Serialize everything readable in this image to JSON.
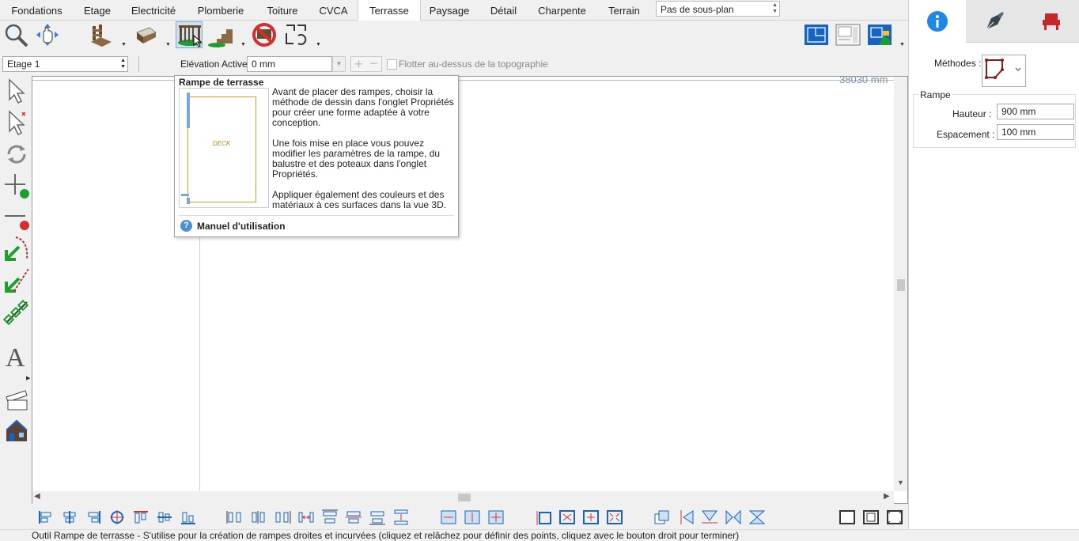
{
  "tabs": [
    "Fondations",
    "Etage",
    "Electricité",
    "Plomberie",
    "Toiture",
    "CVCA",
    "Terrasse",
    "Paysage",
    "Détail",
    "Charpente",
    "Terrain"
  ],
  "active_tab": "Terrasse",
  "subplan_select": "Pas de sous-plan",
  "level_select": "Etage 1",
  "elevation": {
    "label": "Elévation Active:",
    "value": "0 mm"
  },
  "float_checkbox": {
    "label": "Flotter au-dessus de la topographie",
    "checked": false
  },
  "canvas": {
    "dimension_text": "38030 mm"
  },
  "tooltip": {
    "title": "Rampe de terrasse",
    "preview_label": "DECK",
    "paragraphs": [
      "Avant de placer des rampes, choisir la méthode de dessin dans l'onglet Propriétés pour créer une forme adaptée à votre conception.",
      "Une fois mise en place vous pouvez modifier les paramètres de la rampe, du balustre et des poteaux dans l'onglet Propriétés.",
      "Appliquer également des couleurs et des matériaux à ces surfaces dans la vue 3D."
    ],
    "help_link": "Manuel d'utilisation"
  },
  "right_panel": {
    "methods_label": "Méthodes :",
    "group_title": "Rampe",
    "height_label": "Hauteur :",
    "height_value": "900 mm",
    "spacing_label": "Espacement :",
    "spacing_value": "100 mm"
  },
  "status_text": "Outil Rampe de terrasse - S'utilise pour la création de rampes droites et incurvées (cliquez et relâchez pour définir des points, cliquez avec le bouton droit pour terminer)",
  "colors": {
    "accent_blue": "#1565c0",
    "wood_brown": "#6b4a2b",
    "red": "#d32f2f",
    "green": "#1e9e2e",
    "panel_red": "#c62828"
  }
}
